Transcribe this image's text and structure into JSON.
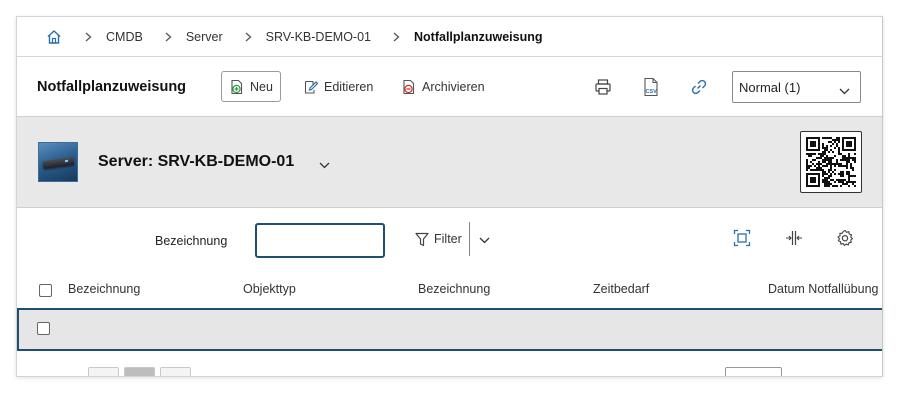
{
  "breadcrumb": {
    "home_icon": "home-icon",
    "items": [
      "CMDB",
      "Server",
      "SRV-KB-DEMO-01",
      "Notfallplanzuweisung"
    ]
  },
  "toolbar": {
    "title": "Notfallplanzuweisung",
    "new_label": "Neu",
    "edit_label": "Editieren",
    "archive_label": "Archivieren",
    "icons": [
      "print-icon",
      "csv-export-icon",
      "link-icon"
    ],
    "view_select": "Normal (1)"
  },
  "object": {
    "title": "Server: SRV-KB-DEMO-01",
    "thumbnail": "server-thumbnail",
    "qr": "qr-code"
  },
  "filter": {
    "label": "Bezeichnung",
    "input_value": "",
    "filter_label": "Filter",
    "icons": [
      "fit-screen-icon",
      "column-resize-icon",
      "settings-icon"
    ]
  },
  "table": {
    "columns": [
      "Bezeichnung",
      "Objekttyp",
      "Bezeichnung",
      "Zeitbedarf",
      "Datum Notfallübung"
    ],
    "rows": [
      [
        "",
        "",
        "",
        "",
        ""
      ]
    ]
  },
  "colors": {
    "accent": "#1e4f6f",
    "header_bg": "#e8e8e8",
    "icon_blue": "#2a6fa8",
    "green": "#2e9b3f",
    "red": "#d0302a"
  }
}
